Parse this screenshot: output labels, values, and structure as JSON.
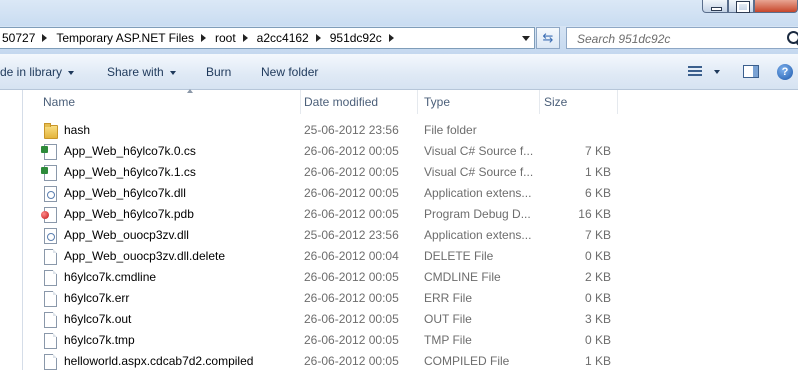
{
  "address": {
    "crumbs": [
      "50727",
      "Temporary ASP.NET Files",
      "root",
      "a2cc4162",
      "951dc92c"
    ]
  },
  "search": {
    "placeholder": "Search 951dc92c"
  },
  "toolbar": {
    "include_library": "de in library",
    "share_with": "Share with",
    "burn": "Burn",
    "new_folder": "New folder",
    "help": "?"
  },
  "columns": {
    "name": "Name",
    "date": "Date modified",
    "type": "Type",
    "size": "Size"
  },
  "files": [
    {
      "name": "hash",
      "date": "25-06-2012 23:56",
      "type": "File folder",
      "size": "",
      "icon": "folder-icon"
    },
    {
      "name": "App_Web_h6ylco7k.0.cs",
      "date": "26-06-2012 00:05",
      "type": "Visual C# Source f...",
      "size": "7 KB",
      "icon": "csharp-file-icon"
    },
    {
      "name": "App_Web_h6ylco7k.1.cs",
      "date": "26-06-2012 00:05",
      "type": "Visual C# Source f...",
      "size": "1 KB",
      "icon": "csharp-file-icon"
    },
    {
      "name": "App_Web_h6ylco7k.dll",
      "date": "26-06-2012 00:05",
      "type": "Application extens...",
      "size": "6 KB",
      "icon": "dll-file-icon"
    },
    {
      "name": "App_Web_h6ylco7k.pdb",
      "date": "26-06-2012 00:05",
      "type": "Program Debug D...",
      "size": "16 KB",
      "icon": "pdb-file-icon"
    },
    {
      "name": "App_Web_ouocp3zv.dll",
      "date": "25-06-2012 23:56",
      "type": "Application extens...",
      "size": "7 KB",
      "icon": "dll-file-icon"
    },
    {
      "name": "App_Web_ouocp3zv.dll.delete",
      "date": "26-06-2012 00:04",
      "type": "DELETE File",
      "size": "0 KB",
      "icon": "generic-file-icon"
    },
    {
      "name": "h6ylco7k.cmdline",
      "date": "26-06-2012 00:05",
      "type": "CMDLINE File",
      "size": "2 KB",
      "icon": "generic-file-icon"
    },
    {
      "name": "h6ylco7k.err",
      "date": "26-06-2012 00:05",
      "type": "ERR File",
      "size": "0 KB",
      "icon": "generic-file-icon"
    },
    {
      "name": "h6ylco7k.out",
      "date": "26-06-2012 00:05",
      "type": "OUT File",
      "size": "3 KB",
      "icon": "generic-file-icon"
    },
    {
      "name": "h6ylco7k.tmp",
      "date": "26-06-2012 00:05",
      "type": "TMP File",
      "size": "0 KB",
      "icon": "generic-file-icon"
    },
    {
      "name": "helloworld.aspx.cdcab7d2.compiled",
      "date": "26-06-2012 00:05",
      "type": "COMPILED File",
      "size": "1 KB",
      "icon": "generic-file-icon"
    }
  ]
}
